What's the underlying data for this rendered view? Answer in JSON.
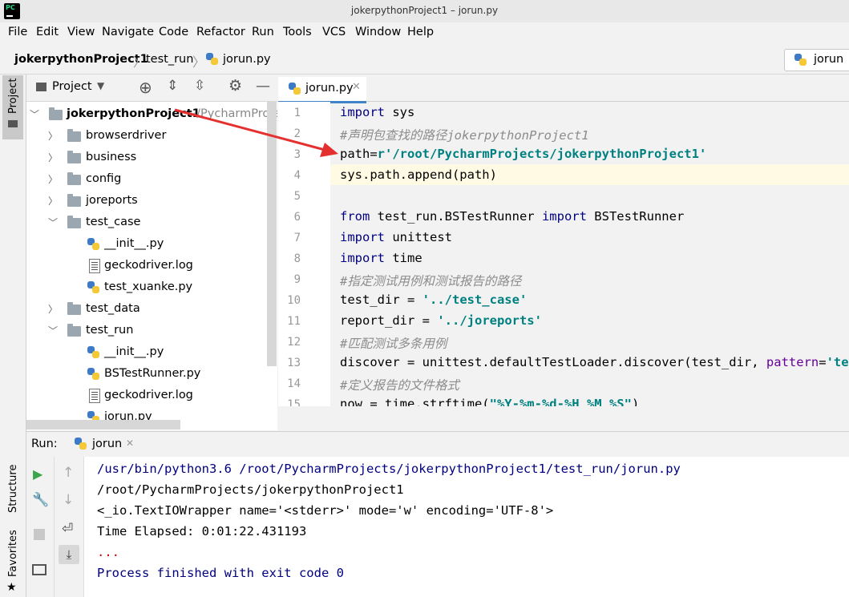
{
  "window": {
    "title": "jokerpythonProject1 – jorun.py"
  },
  "menu": [
    "File",
    "Edit",
    "View",
    "Navigate",
    "Code",
    "Refactor",
    "Run",
    "Tools",
    "VCS",
    "Window",
    "Help"
  ],
  "breadcrumb": [
    "jokerpythonProject1",
    "test_run",
    "jorun.py"
  ],
  "run_config": "jorun",
  "project_panel": {
    "title": "Project",
    "tree": [
      {
        "label": "jokerpythonProject1",
        "suffix": "~/PycharmProject",
        "bold": true
      },
      {
        "label": "browserdriver"
      },
      {
        "label": "business"
      },
      {
        "label": "config"
      },
      {
        "label": "joreports"
      },
      {
        "label": "test_case"
      },
      {
        "label": "__init__.py"
      },
      {
        "label": "geckodriver.log"
      },
      {
        "label": "test_xuanke.py"
      },
      {
        "label": "test_data"
      },
      {
        "label": "test_run"
      },
      {
        "label": "__init__.py"
      },
      {
        "label": "BSTestRunner.py"
      },
      {
        "label": "geckodriver.log"
      },
      {
        "label": "jorun.py"
      }
    ]
  },
  "editor": {
    "tab": "jorun.py",
    "line_numbers": [
      "1",
      "2",
      "3",
      "4",
      "5",
      "6",
      "7",
      "8",
      "9",
      "10",
      "11",
      "12",
      "13",
      "14",
      "15"
    ],
    "code": {
      "l1_kw": "import",
      "l1_rest": " sys",
      "l2": "#声明包查找的路径jokerpythonProject1",
      "l3_a": "path=",
      "l3_str": "r'/root/PycharmProjects/jokerpythonProject1'",
      "l4": "sys.path.append(path)",
      "l6_kw1": "from",
      "l6_mid": " test_run.BSTestRunner ",
      "l6_kw2": "import",
      "l6_rest": " BSTestRunner",
      "l7_kw": "import",
      "l7_rest": " unittest",
      "l8_kw": "import",
      "l8_rest": " time",
      "l9": "#指定测试用例和测试报告的路径",
      "l10_a": "test_dir = ",
      "l10_str": "'../test_case'",
      "l11_a": "report_dir = ",
      "l11_str": "'../joreports'",
      "l12": "#匹配测试多条用例",
      "l13_a": "discover = unittest.defaultTestLoader.discover(test_dir, ",
      "l13_param": "pattern",
      "l13_eq": "=",
      "l13_str": "'test_",
      "l14": "#定义报告的文件格式",
      "l15_a": "now = time.strftime(",
      "l15_str": "\"%Y-%m-%d-%H %M %S\"",
      "l15_b": ")"
    }
  },
  "run_panel": {
    "label": "Run:",
    "tab": "jorun",
    "console": [
      {
        "text": "/usr/bin/python3.6 /root/PycharmProjects/jokerpythonProject1/test_run/jorun.py",
        "color": "#000080"
      },
      {
        "text": "/root/PycharmProjects/jokerpythonProject1",
        "color": "#000000"
      },
      {
        "text": "<_io.TextIOWrapper name='<stderr>' mode='w' encoding='UTF-8'>",
        "color": "#000000"
      },
      {
        "text": "Time Elapsed: 0:01:22.431193",
        "color": "#000000"
      },
      {
        "text": "...",
        "color": "#cc0000"
      },
      {
        "text": "Process finished with exit code 0",
        "color": "#000080"
      }
    ]
  },
  "side_stripes": {
    "project": "Project",
    "structure": "Structure",
    "favorites": "Favorites"
  },
  "colors": {
    "annotation_arrow": "#e53030",
    "tab_underline": "#4083c9"
  }
}
